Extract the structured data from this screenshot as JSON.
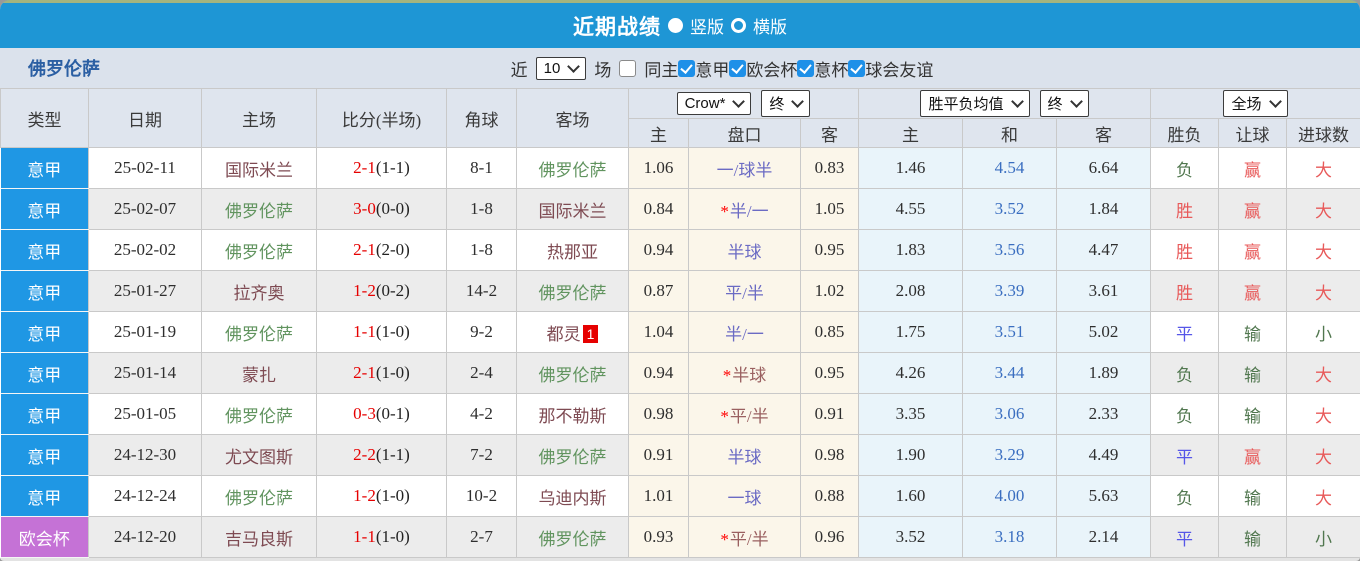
{
  "titlebar": {
    "title": "近期战绩",
    "layout_options": [
      {
        "label": "竖版",
        "selected": true
      },
      {
        "label": "横版",
        "selected": false
      }
    ]
  },
  "filterbar": {
    "team": "佛罗伦萨",
    "recent_prefix": "近",
    "recent_count": "10",
    "recent_suffix": "场",
    "same_home": {
      "label": "同主",
      "checked": false
    },
    "competitions": [
      {
        "label": "意甲",
        "checked": true
      },
      {
        "label": "欧会杯",
        "checked": true
      },
      {
        "label": "意杯",
        "checked": true
      },
      {
        "label": "球会友谊",
        "checked": true
      }
    ]
  },
  "table": {
    "headers": {
      "static": [
        "类型",
        "日期",
        "主场",
        "比分(半场)",
        "角球",
        "客场"
      ],
      "handicap_group": {
        "selects": [
          "Crow*",
          "终"
        ],
        "cols": [
          "主",
          "盘口",
          "客"
        ]
      },
      "avg_group": {
        "selects": [
          "胜平负均值",
          "终"
        ],
        "cols": [
          "主",
          "和",
          "客"
        ]
      },
      "result_group": {
        "selects": [
          "全场"
        ],
        "cols": [
          "胜负",
          "让球",
          "进球数"
        ]
      }
    },
    "rows": [
      {
        "type": {
          "label": "意甲",
          "tone": "blue"
        },
        "date": "25-02-11",
        "home": {
          "name": "国际米兰",
          "self": false,
          "badge": ""
        },
        "score": "2-1",
        "half": "(1-1)",
        "corner": "8-1",
        "away": {
          "name": "佛罗伦萨",
          "self": true,
          "badge": ""
        },
        "handicap_odds": {
          "home": "1.06",
          "away": "0.83"
        },
        "handicap": {
          "star": false,
          "text": "一/球半",
          "tone": "hblue"
        },
        "avg": {
          "home": "1.46",
          "draw": "4.54",
          "away": "6.64"
        },
        "result": {
          "text": "负",
          "tone": "green"
        },
        "cover": {
          "text": "赢",
          "tone": "red"
        },
        "goals": {
          "text": "大",
          "tone": "red"
        }
      },
      {
        "type": {
          "label": "意甲",
          "tone": "blue"
        },
        "date": "25-02-07",
        "home": {
          "name": "佛罗伦萨",
          "self": true,
          "badge": ""
        },
        "score": "3-0",
        "half": "(0-0)",
        "corner": "1-8",
        "away": {
          "name": "国际米兰",
          "self": false,
          "badge": ""
        },
        "handicap_odds": {
          "home": "0.84",
          "away": "1.05"
        },
        "handicap": {
          "star": true,
          "text": "半/一",
          "tone": "hblue"
        },
        "avg": {
          "home": "4.55",
          "draw": "3.52",
          "away": "1.84"
        },
        "result": {
          "text": "胜",
          "tone": "red"
        },
        "cover": {
          "text": "赢",
          "tone": "red"
        },
        "goals": {
          "text": "大",
          "tone": "red"
        }
      },
      {
        "type": {
          "label": "意甲",
          "tone": "blue"
        },
        "date": "25-02-02",
        "home": {
          "name": "佛罗伦萨",
          "self": true,
          "badge": ""
        },
        "score": "2-1",
        "half": "(2-0)",
        "corner": "1-8",
        "away": {
          "name": "热那亚",
          "self": false,
          "badge": ""
        },
        "handicap_odds": {
          "home": "0.94",
          "away": "0.95"
        },
        "handicap": {
          "star": false,
          "text": "半球",
          "tone": "hblue"
        },
        "avg": {
          "home": "1.83",
          "draw": "3.56",
          "away": "4.47"
        },
        "result": {
          "text": "胜",
          "tone": "red"
        },
        "cover": {
          "text": "赢",
          "tone": "red"
        },
        "goals": {
          "text": "大",
          "tone": "red"
        }
      },
      {
        "type": {
          "label": "意甲",
          "tone": "blue"
        },
        "date": "25-01-27",
        "home": {
          "name": "拉齐奥",
          "self": false,
          "badge": ""
        },
        "score": "1-2",
        "half": "(0-2)",
        "corner": "14-2",
        "away": {
          "name": "佛罗伦萨",
          "self": true,
          "badge": ""
        },
        "handicap_odds": {
          "home": "0.87",
          "away": "1.02"
        },
        "handicap": {
          "star": false,
          "text": "平/半",
          "tone": "hblue"
        },
        "avg": {
          "home": "2.08",
          "draw": "3.39",
          "away": "3.61"
        },
        "result": {
          "text": "胜",
          "tone": "red"
        },
        "cover": {
          "text": "赢",
          "tone": "red"
        },
        "goals": {
          "text": "大",
          "tone": "red"
        }
      },
      {
        "type": {
          "label": "意甲",
          "tone": "blue"
        },
        "date": "25-01-19",
        "home": {
          "name": "佛罗伦萨",
          "self": true,
          "badge": ""
        },
        "score": "1-1",
        "half": "(1-0)",
        "corner": "9-2",
        "away": {
          "name": "都灵",
          "self": false,
          "badge": "1"
        },
        "handicap_odds": {
          "home": "1.04",
          "away": "0.85"
        },
        "handicap": {
          "star": false,
          "text": "半/一",
          "tone": "hblue"
        },
        "avg": {
          "home": "1.75",
          "draw": "3.51",
          "away": "5.02"
        },
        "result": {
          "text": "平",
          "tone": "blue"
        },
        "cover": {
          "text": "输",
          "tone": "green"
        },
        "goals": {
          "text": "小",
          "tone": "green"
        }
      },
      {
        "type": {
          "label": "意甲",
          "tone": "blue"
        },
        "date": "25-01-14",
        "home": {
          "name": "蒙扎",
          "self": false,
          "badge": ""
        },
        "score": "2-1",
        "half": "(1-0)",
        "corner": "2-4",
        "away": {
          "name": "佛罗伦萨",
          "self": true,
          "badge": ""
        },
        "handicap_odds": {
          "home": "0.94",
          "away": "0.95"
        },
        "handicap": {
          "star": true,
          "text": "半球",
          "tone": "maroon"
        },
        "avg": {
          "home": "4.26",
          "draw": "3.44",
          "away": "1.89"
        },
        "result": {
          "text": "负",
          "tone": "green"
        },
        "cover": {
          "text": "输",
          "tone": "green"
        },
        "goals": {
          "text": "大",
          "tone": "red"
        }
      },
      {
        "type": {
          "label": "意甲",
          "tone": "blue"
        },
        "date": "25-01-05",
        "home": {
          "name": "佛罗伦萨",
          "self": true,
          "badge": ""
        },
        "score": "0-3",
        "half": "(0-1)",
        "corner": "4-2",
        "away": {
          "name": "那不勒斯",
          "self": false,
          "badge": ""
        },
        "handicap_odds": {
          "home": "0.98",
          "away": "0.91"
        },
        "handicap": {
          "star": true,
          "text": "平/半",
          "tone": "maroon"
        },
        "avg": {
          "home": "3.35",
          "draw": "3.06",
          "away": "2.33"
        },
        "result": {
          "text": "负",
          "tone": "green"
        },
        "cover": {
          "text": "输",
          "tone": "green"
        },
        "goals": {
          "text": "大",
          "tone": "red"
        }
      },
      {
        "type": {
          "label": "意甲",
          "tone": "blue"
        },
        "date": "24-12-30",
        "home": {
          "name": "尤文图斯",
          "self": false,
          "badge": ""
        },
        "score": "2-2",
        "half": "(1-1)",
        "corner": "7-2",
        "away": {
          "name": "佛罗伦萨",
          "self": true,
          "badge": ""
        },
        "handicap_odds": {
          "home": "0.91",
          "away": "0.98"
        },
        "handicap": {
          "star": false,
          "text": "半球",
          "tone": "hblue"
        },
        "avg": {
          "home": "1.90",
          "draw": "3.29",
          "away": "4.49"
        },
        "result": {
          "text": "平",
          "tone": "blue"
        },
        "cover": {
          "text": "赢",
          "tone": "red"
        },
        "goals": {
          "text": "大",
          "tone": "red"
        }
      },
      {
        "type": {
          "label": "意甲",
          "tone": "blue"
        },
        "date": "24-12-24",
        "home": {
          "name": "佛罗伦萨",
          "self": true,
          "badge": ""
        },
        "score": "1-2",
        "half": "(1-0)",
        "corner": "10-2",
        "away": {
          "name": "乌迪内斯",
          "self": false,
          "badge": ""
        },
        "handicap_odds": {
          "home": "1.01",
          "away": "0.88"
        },
        "handicap": {
          "star": false,
          "text": "一球",
          "tone": "hblue"
        },
        "avg": {
          "home": "1.60",
          "draw": "4.00",
          "away": "5.63"
        },
        "result": {
          "text": "负",
          "tone": "green"
        },
        "cover": {
          "text": "输",
          "tone": "green"
        },
        "goals": {
          "text": "大",
          "tone": "red"
        }
      },
      {
        "type": {
          "label": "欧会杯",
          "tone": "purple"
        },
        "date": "24-12-20",
        "home": {
          "name": "吉马良斯",
          "self": false,
          "badge": ""
        },
        "score": "1-1",
        "half": "(1-0)",
        "corner": "2-7",
        "away": {
          "name": "佛罗伦萨",
          "self": true,
          "badge": ""
        },
        "handicap_odds": {
          "home": "0.93",
          "away": "0.96"
        },
        "handicap": {
          "star": true,
          "text": "平/半",
          "tone": "maroon"
        },
        "avg": {
          "home": "3.52",
          "draw": "3.18",
          "away": "2.14"
        },
        "result": {
          "text": "平",
          "tone": "blue"
        },
        "cover": {
          "text": "输",
          "tone": "green"
        },
        "goals": {
          "text": "小",
          "tone": "green"
        }
      }
    ]
  },
  "colors": {
    "titlebar_blue": "#1e96d5",
    "league_blue": "#1f97e4",
    "cup_purple": "#c572d6",
    "score_red": "#e60000",
    "team_self_green": "#61945f",
    "team_opp_maroon": "#7e4a52",
    "avg_draw_blue": "#3a6ec0",
    "win_red": "#e85a5a",
    "draw_blue": "#5656e8",
    "lose_green": "#51774f",
    "handicap_blue": "#6b6bc4",
    "handicap_maroon": "#9a6060"
  }
}
